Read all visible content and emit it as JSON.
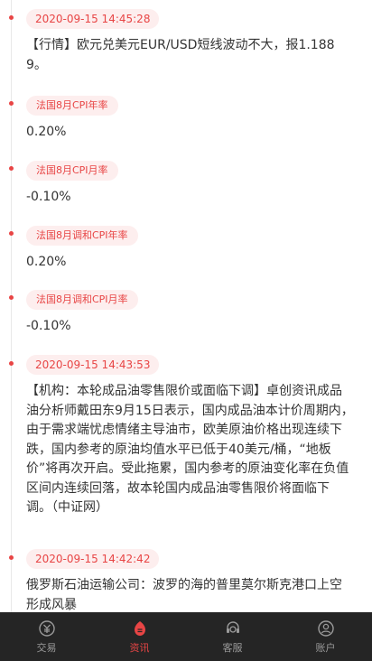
{
  "feed": {
    "items": [
      {
        "tag": "2020-09-15 14:45:28",
        "tag_type": "time",
        "text": "【行情】欧元兑美元EUR/USD短线波动不大，报1.1889。"
      },
      {
        "tag": "法国8月CPI年率",
        "tag_type": "label",
        "text": "0.20%"
      },
      {
        "tag": "法国8月CPI月率",
        "tag_type": "label",
        "text": "-0.10%"
      },
      {
        "tag": "法国8月调和CPI年率",
        "tag_type": "label",
        "text": "0.20%"
      },
      {
        "tag": "法国8月调和CPI月率",
        "tag_type": "label",
        "text": "-0.10%"
      },
      {
        "tag": "2020-09-15 14:43:53",
        "tag_type": "time",
        "text": "【机构：本轮成品油零售限价或面临下调】卓创资讯成品油分析师戴田东9月15日表示，国内成品油本计价周期内，由于需求端忧虑情绪主导油市，欧美原油价格出现连续下跌，国内参考的原油均值水平已低于40美元/桶，“地板价”将再次开启。受此拖累，国内参考的原油变化率在负值区间内连续回落，故本轮国内成品油零售限价将面临下调。（中证网）"
      },
      {
        "tag": "2020-09-15 14:42:42",
        "tag_type": "time",
        "text": "俄罗斯石油运输公司：波罗的海的普里莫尔斯克港口上空形成风暴"
      }
    ]
  },
  "tabbar": {
    "tabs": [
      {
        "label": "交易",
        "icon": "trade-icon",
        "active": false
      },
      {
        "label": "资讯",
        "icon": "news-icon",
        "active": true
      },
      {
        "label": "客服",
        "icon": "service-icon",
        "active": false
      },
      {
        "label": "账户",
        "icon": "account-icon",
        "active": false
      }
    ]
  },
  "colors": {
    "accent": "#e84545",
    "tag_bg": "#fdeeee",
    "tabbar_bg": "#252525",
    "tab_inactive": "#9a9a9a",
    "text": "#333333"
  }
}
